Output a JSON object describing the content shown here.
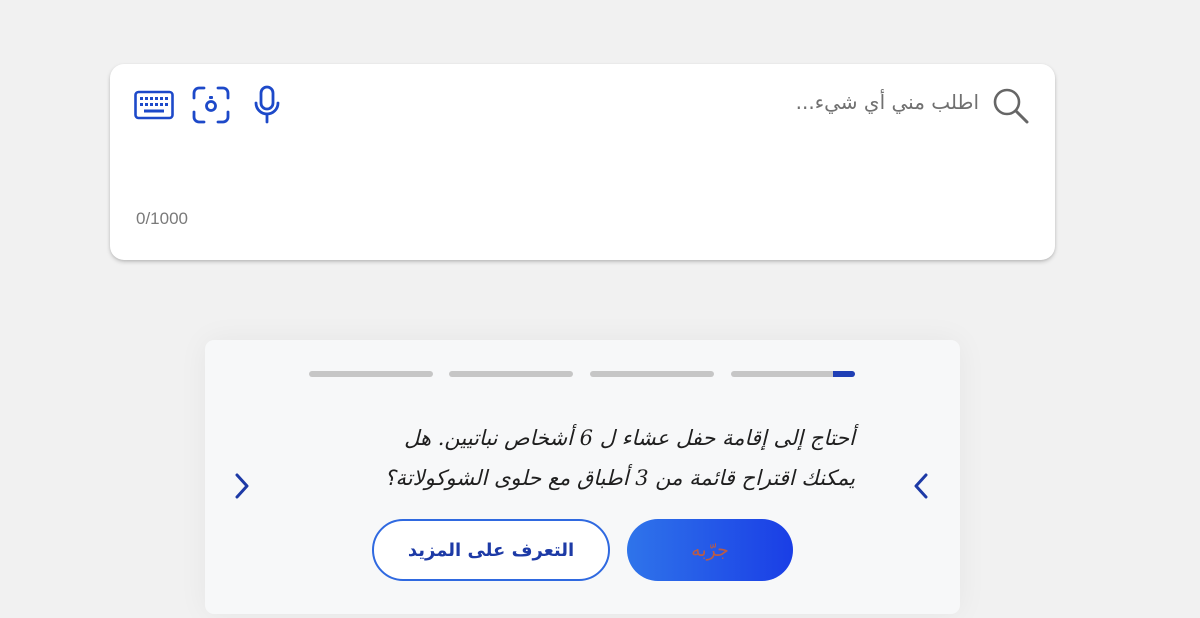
{
  "search": {
    "placeholder": "اطلب مني أي شيء...",
    "char_count": "0/1000",
    "icons": [
      "search-icon",
      "keyboard-icon",
      "visual-search-icon",
      "microphone-icon"
    ]
  },
  "suggestions": {
    "total_slides": 4,
    "active_slide": 1,
    "active_slide_progress": 0.18,
    "prompt_line1": "أحتاج إلى إقامة حفل عشاء ل 6 أشخاص نباتيين. هل",
    "prompt_line2": "يمكنك اقتراح قائمة من 3 أطباق مع حلوى الشوكولاتة؟",
    "try_label": "جرّبه",
    "learn_more_label": "التعرف على المزيد"
  },
  "colors": {
    "accent": "#1f3fb5",
    "icon_blue": "#1d49c9",
    "button_gradient_start": "#2f74ea",
    "button_gradient_end": "#1a3ee6",
    "page_background": "#f1f1f1"
  }
}
